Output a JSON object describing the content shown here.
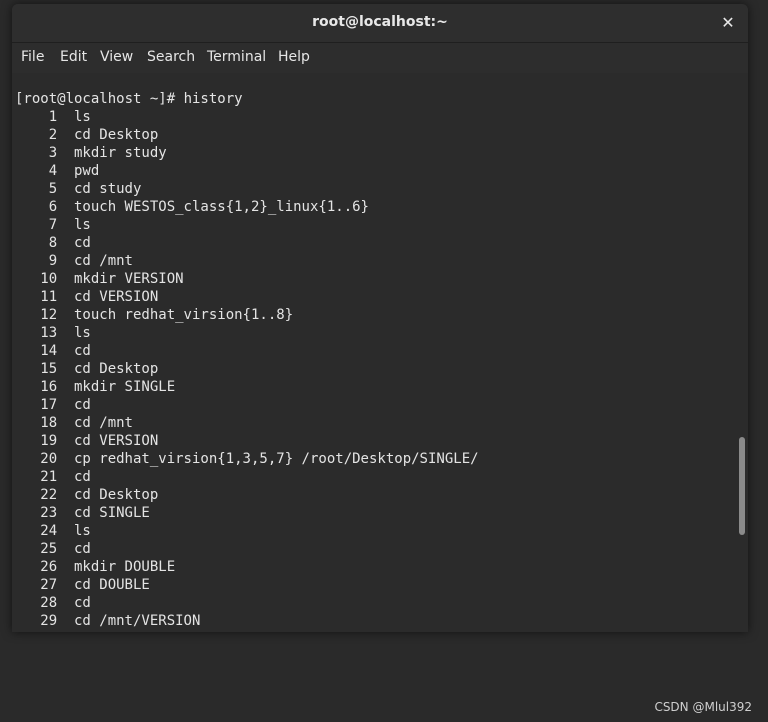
{
  "window": {
    "title": "root@localhost:~",
    "close_glyph": "✕"
  },
  "menu": [
    "File",
    "Edit",
    "View",
    "Search",
    "Terminal",
    "Help"
  ],
  "terminal": {
    "prompt_line": "[root@localhost ~]# history",
    "history": [
      {
        "num": "1",
        "cmd": "ls"
      },
      {
        "num": "2",
        "cmd": "cd Desktop"
      },
      {
        "num": "3",
        "cmd": "mkdir study"
      },
      {
        "num": "4",
        "cmd": "pwd"
      },
      {
        "num": "5",
        "cmd": "cd study"
      },
      {
        "num": "6",
        "cmd": "touch WESTOS_class{1,2}_linux{1..6}"
      },
      {
        "num": "7",
        "cmd": "ls"
      },
      {
        "num": "8",
        "cmd": "cd"
      },
      {
        "num": "9",
        "cmd": "cd /mnt"
      },
      {
        "num": "10",
        "cmd": "mkdir VERSION"
      },
      {
        "num": "11",
        "cmd": "cd VERSION"
      },
      {
        "num": "12",
        "cmd": "touch redhat_virsion{1..8}"
      },
      {
        "num": "13",
        "cmd": "ls"
      },
      {
        "num": "14",
        "cmd": "cd"
      },
      {
        "num": "15",
        "cmd": "cd Desktop"
      },
      {
        "num": "16",
        "cmd": "mkdir SINGLE"
      },
      {
        "num": "17",
        "cmd": "cd"
      },
      {
        "num": "18",
        "cmd": "cd /mnt"
      },
      {
        "num": "19",
        "cmd": "cd VERSION"
      },
      {
        "num": "20",
        "cmd": "cp redhat_virsion{1,3,5,7} /root/Desktop/SINGLE/"
      },
      {
        "num": "21",
        "cmd": "cd"
      },
      {
        "num": "22",
        "cmd": "cd Desktop"
      },
      {
        "num": "23",
        "cmd": "cd SINGLE"
      },
      {
        "num": "24",
        "cmd": "ls"
      },
      {
        "num": "25",
        "cmd": "cd"
      },
      {
        "num": "26",
        "cmd": "mkdir DOUBLE"
      },
      {
        "num": "27",
        "cmd": "cd DOUBLE"
      },
      {
        "num": "28",
        "cmd": "cd"
      },
      {
        "num": "29",
        "cmd": "cd /mnt/VERSION"
      }
    ]
  },
  "watermark": "CSDN @Mlul392",
  "colors": {
    "terminal_bg": "#2b2b2b",
    "terminal_fg": "#e4e4e4",
    "titlebar_bg": "#2e2e2e"
  }
}
